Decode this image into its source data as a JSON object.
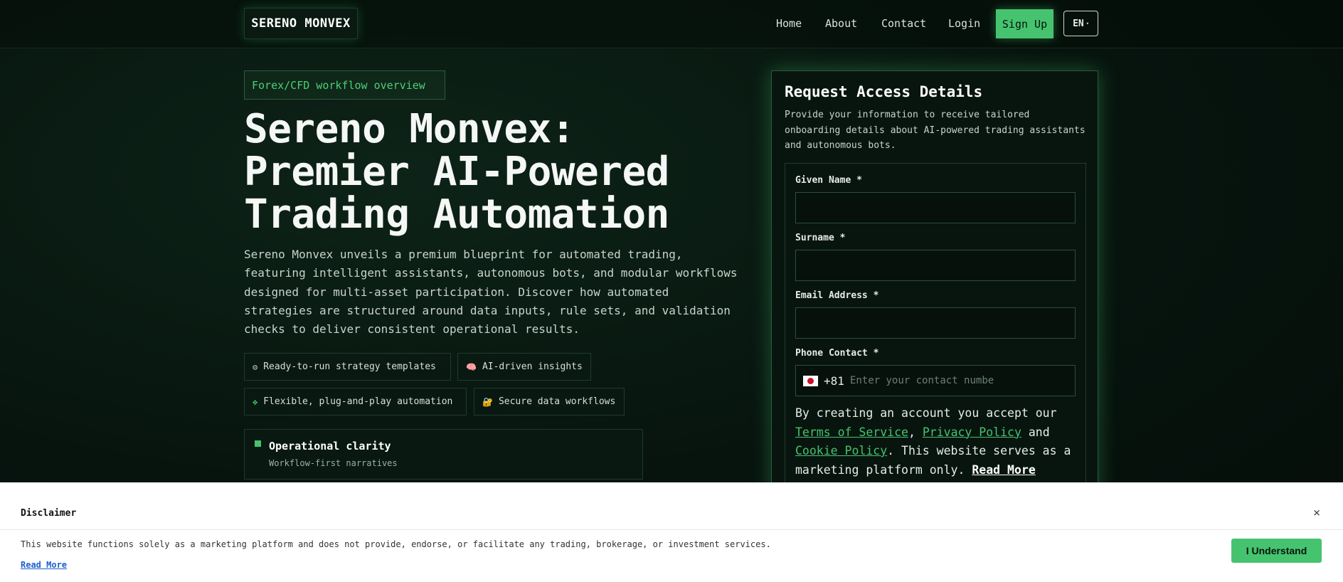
{
  "nav": {
    "logo": "SERENO MONVEX",
    "links": [
      "Home",
      "About",
      "Contact",
      "Login"
    ],
    "signup": "Sign Up",
    "lang": "EN",
    "lang_caret": "▾"
  },
  "hero": {
    "tag": "Forex/CFD workflow overview",
    "headline_lines": [
      "Sereno Monvex:",
      "Premier AI-Powered",
      "Trading Automation"
    ],
    "description": "Sereno Monvex unveils a premium blueprint for automated trading, featuring intelligent assistants, autonomous bots, and modular workflows designed for multi-asset participation. Discover how automated strategies are structured around data inputs, rule sets, and validation checks to deliver consistent operational results.",
    "chips": [
      {
        "icon": "⚙",
        "label": "Ready-to-run strategy templates"
      },
      {
        "icon": "🧠",
        "label": "AI-driven insights"
      },
      {
        "icon": "✥",
        "label": "Flexible, plug-and-play automation"
      },
      {
        "icon": "🔐",
        "label": "Secure data workflows"
      }
    ],
    "clarity": {
      "title": "Operational clarity",
      "subtitle": "Workflow-first narratives"
    }
  },
  "form": {
    "title": "Request Access Details",
    "subtitle": "Provide your information to receive tailored onboarding details about AI-powered trading assistants and autonomous bots.",
    "given_name_label": "Given Name *",
    "surname_label": "Surname *",
    "email_label": "Email Address *",
    "phone_label": "Phone Contact *",
    "phone_code": "+81",
    "phone_placeholder": "Enter your contact numbe",
    "consent_prefix": "By creating an account you accept our",
    "terms": "Terms of Service",
    "comma": ",",
    "privacy": "Privacy Policy",
    "and": "and",
    "cookie": "Cookie Policy",
    "consent_suffix": ". This website serves as a marketing platform only.",
    "read_more": "Read More"
  },
  "disclaimer": {
    "title": "Disclaimer",
    "close": "×",
    "text": "This website functions solely as a marketing platform and does not provide, endorse, or facilitate any trading, brokerage, or investment services.",
    "read_more": "Read More",
    "button": "I Understand"
  },
  "colors": {
    "accent": "#46c36f",
    "background": "#07140e",
    "card": "#08150f"
  }
}
